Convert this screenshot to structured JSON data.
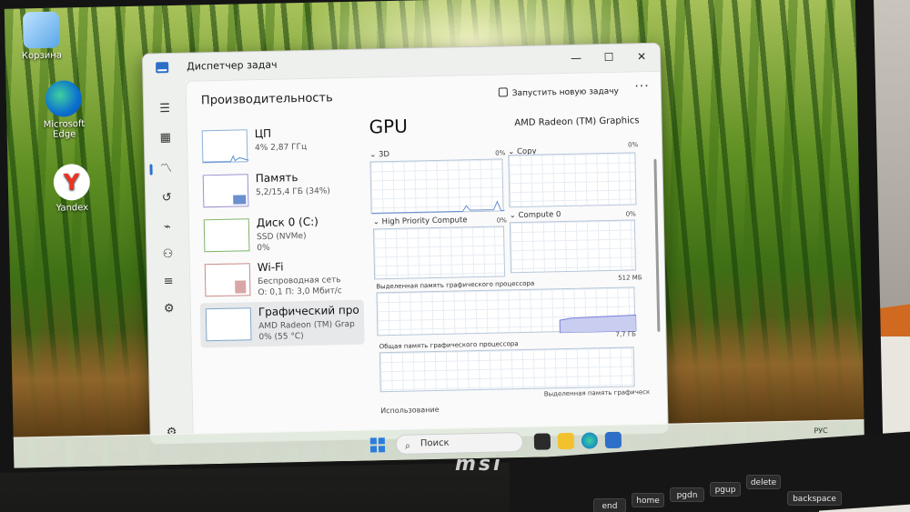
{
  "desktop": {
    "icons": [
      {
        "label": "Корзина",
        "icon": "recycle-bin-icon"
      },
      {
        "label": "Microsoft Edge",
        "icon": "edge-icon"
      },
      {
        "label": "Yandex",
        "icon": "yandex-browser-icon"
      }
    ]
  },
  "window": {
    "title": "Диспетчер задач",
    "controls": {
      "minimize": "—",
      "maximize": "☐",
      "close": "✕"
    }
  },
  "header": {
    "title": "Производительность",
    "run_task": "Запустить новую задачу",
    "more": "···"
  },
  "nav_icons": [
    "menu-icon",
    "processes-icon",
    "performance-icon",
    "app-history-icon",
    "startup-icon",
    "users-icon",
    "details-icon",
    "services-icon",
    "settings-icon"
  ],
  "list": [
    {
      "name": "ЦП",
      "sub1": "4% 2,87 ГГц",
      "sub2": ""
    },
    {
      "name": "Память",
      "sub1": "5,2/15,4 ГБ (34%)",
      "sub2": ""
    },
    {
      "name": "Диск 0 (C:)",
      "sub1": "SSD (NVMe)",
      "sub2": "0%"
    },
    {
      "name": "Wi-Fi",
      "sub1": "Беспроводная сеть",
      "sub2": "О: 0,1 П: 3,0 Мбит/с"
    },
    {
      "name": "Графический про",
      "sub1": "AMD Radeon (TM) Grap",
      "sub2": "0% (55 °C)"
    }
  ],
  "gpu": {
    "heading": "GPU",
    "adapter": "AMD Radeon (TM) Graphics",
    "engines": [
      {
        "label": "3D",
        "pct": "0%"
      },
      {
        "label": "Copy",
        "pct": "0%"
      },
      {
        "label": "High Priority Compute",
        "pct": "0%"
      },
      {
        "label": "Compute 0",
        "pct": "0%"
      }
    ],
    "dedicated": {
      "label": "Выделенная память графического процессора",
      "max": "512 МБ",
      "value": "7,7 ГБ"
    },
    "shared": {
      "label": "Общая память графического процессора",
      "footer": "Выделенная память графическ"
    },
    "usage_label": "Использование"
  },
  "taskbar": {
    "search_placeholder": "Поиск",
    "apps": [
      "file-manager-icon",
      "explorer-icon",
      "edge-icon",
      "task-manager-icon"
    ],
    "tray": "РУС"
  },
  "laptop": {
    "brand": "msi",
    "keys": [
      "delete",
      "backspace",
      "pgup",
      "pgdn",
      "home",
      "end"
    ]
  }
}
